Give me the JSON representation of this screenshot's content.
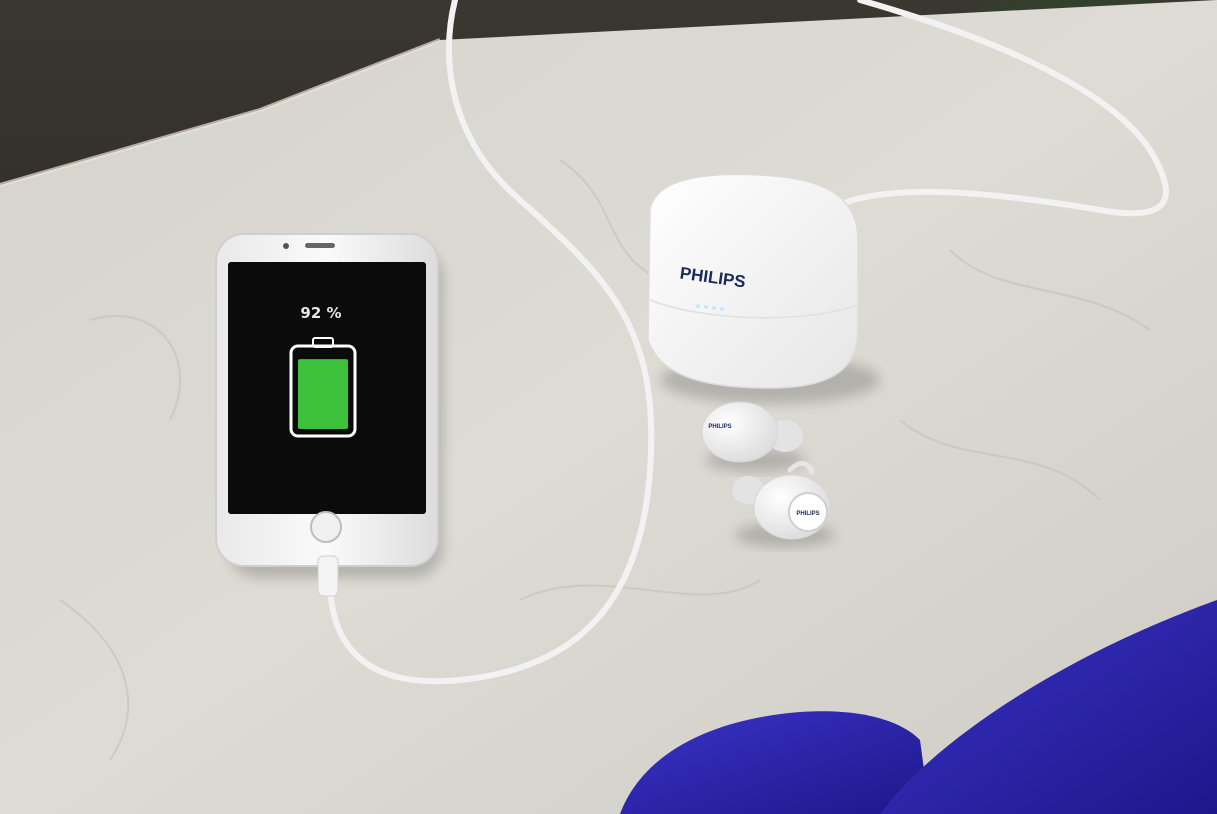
{
  "phone_screen": {
    "battery_percent_text": "92 %",
    "battery_level": 0.92,
    "battery_fill_color": "#3ec13a",
    "screen_color": "#0b0b0b"
  },
  "charging_case": {
    "brand_text": "PHILIPS",
    "led_color": "#bfe3ff"
  },
  "earbud_top": {
    "brand_text": "PHILIPS"
  },
  "earbud_bottom": {
    "brand_text": "PHILIPS"
  },
  "scene_colors": {
    "tablecloth": "#d9d6d0",
    "background_dark": "#2c2a26",
    "fabric_blue": "#2a23a8",
    "white_device": "#f4f4f4",
    "cable": "#f2f2f2"
  }
}
